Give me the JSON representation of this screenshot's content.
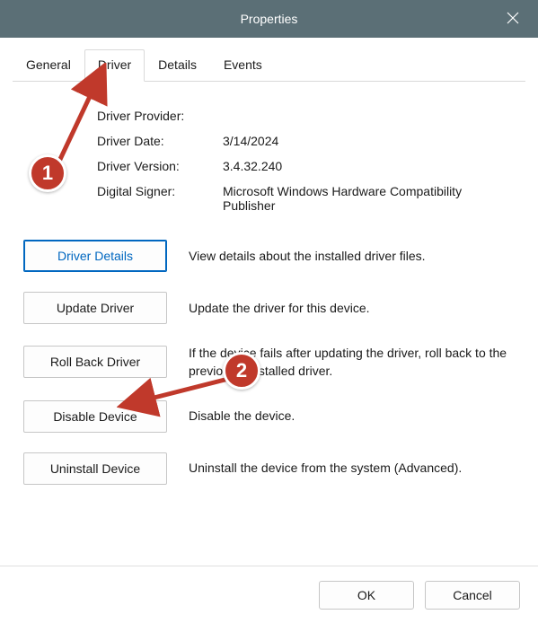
{
  "titlebar": {
    "title": "Properties"
  },
  "tabs": {
    "general": "General",
    "driver": "Driver",
    "details": "Details",
    "events": "Events",
    "active": "driver"
  },
  "driver_info": {
    "provider_label": "Driver Provider:",
    "provider_value": "",
    "date_label": "Driver Date:",
    "date_value": "3/14/2024",
    "version_label": "Driver Version:",
    "version_value": "3.4.32.240",
    "signer_label": "Digital Signer:",
    "signer_value": "Microsoft Windows Hardware Compatibility Publisher"
  },
  "actions": {
    "details": {
      "label": "Driver Details",
      "desc": "View details about the installed driver files."
    },
    "update": {
      "label": "Update Driver",
      "desc": "Update the driver for this device."
    },
    "rollback": {
      "label": "Roll Back Driver",
      "desc": "If the device fails after updating the driver, roll back to the previously installed driver."
    },
    "disable": {
      "label": "Disable Device",
      "desc": "Disable the device."
    },
    "uninstall": {
      "label": "Uninstall Device",
      "desc": "Uninstall the device from the system (Advanced)."
    }
  },
  "buttons": {
    "ok": "OK",
    "cancel": "Cancel"
  },
  "annotations": {
    "badge1": "1",
    "badge2": "2"
  },
  "colors": {
    "titlebar": "#5b6f76",
    "accent": "#0067c0",
    "badge": "#c0392b",
    "arrow": "#c0392b"
  }
}
